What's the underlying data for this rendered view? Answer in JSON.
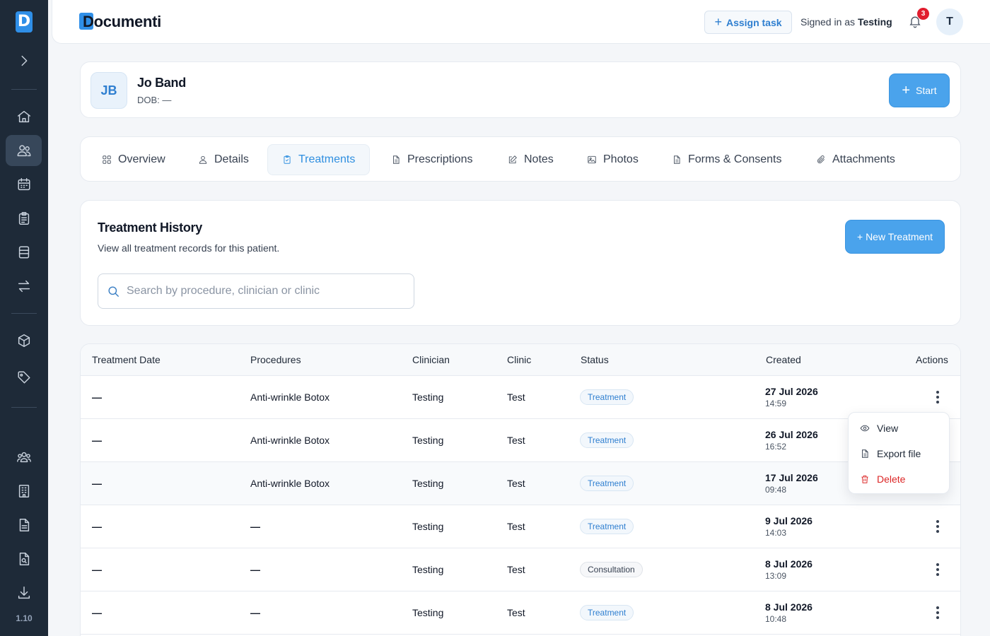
{
  "sidebar": {
    "logo_letter": "D",
    "version": "1.10",
    "items": [
      {
        "icon": "chevron-right-icon"
      },
      {
        "icon": "home-icon"
      },
      {
        "icon": "users-icon",
        "active": true
      },
      {
        "icon": "calendar-icon"
      },
      {
        "icon": "clipboard-icon"
      },
      {
        "icon": "layout-icon"
      },
      {
        "icon": "transfer-icon"
      },
      {
        "icon": "box-icon"
      },
      {
        "icon": "tag-icon"
      },
      {
        "icon": "team-icon"
      },
      {
        "icon": "building-icon"
      },
      {
        "icon": "file-text-icon"
      },
      {
        "icon": "file-search-icon"
      },
      {
        "icon": "download-icon"
      }
    ]
  },
  "header": {
    "brand": "Documenti",
    "assign_task": "Assign task",
    "signed_in_prefix": "Signed in as",
    "signed_in_user": "Testing",
    "notification_count": "3",
    "user_initial": "T"
  },
  "patient": {
    "initials": "JB",
    "name": "Jo Band",
    "dob": "DOB: —",
    "start_label": "Start"
  },
  "tabs": [
    {
      "label": "Overview",
      "icon": "grid-icon"
    },
    {
      "label": "Details",
      "icon": "user-icon"
    },
    {
      "label": "Treatments",
      "icon": "clipboard-check-icon",
      "active": true
    },
    {
      "label": "Prescriptions",
      "icon": "file-icon"
    },
    {
      "label": "Notes",
      "icon": "edit-icon"
    },
    {
      "label": "Photos",
      "icon": "image-icon"
    },
    {
      "label": "Forms & Consents",
      "icon": "file-icon"
    },
    {
      "label": "Attachments",
      "icon": "paperclip-icon"
    }
  ],
  "history": {
    "title": "Treatment History",
    "subtitle": "View all treatment records for this patient.",
    "new_button": "+ New Treatment",
    "search_placeholder": "Search by procedure, clinician or clinic"
  },
  "table": {
    "columns": [
      "Treatment Date",
      "Procedures",
      "Clinician",
      "Clinic",
      "Status",
      "Created",
      "Actions"
    ],
    "rows": [
      {
        "date": "—",
        "procedures": "Anti-wrinkle Botox",
        "clinician": "Testing",
        "clinic": "Test",
        "status": "Treatment",
        "created_date": "27 Jul 2026",
        "created_time": "14:59"
      },
      {
        "date": "—",
        "procedures": "Anti-wrinkle Botox",
        "clinician": "Testing",
        "clinic": "Test",
        "status": "Treatment",
        "created_date": "26 Jul 2026",
        "created_time": "16:52"
      },
      {
        "date": "—",
        "procedures": "Anti-wrinkle Botox",
        "clinician": "Testing",
        "clinic": "Test",
        "status": "Treatment",
        "created_date": "17 Jul 2026",
        "created_time": "09:48"
      },
      {
        "date": "—",
        "procedures": "—",
        "clinician": "Testing",
        "clinic": "Test",
        "status": "Treatment",
        "created_date": "9 Jul 2026",
        "created_time": "14:03"
      },
      {
        "date": "—",
        "procedures": "—",
        "clinician": "Testing",
        "clinic": "Test",
        "status": "Consultation",
        "created_date": "8 Jul 2026",
        "created_time": "13:09"
      },
      {
        "date": "—",
        "procedures": "—",
        "clinician": "Testing",
        "clinic": "Test",
        "status": "Treatment",
        "created_date": "8 Jul 2026",
        "created_time": "10:48"
      }
    ]
  },
  "row_menu": {
    "view": "View",
    "export": "Export file",
    "delete": "Delete"
  },
  "colors": {
    "accent": "#4aa3ec",
    "sidebar_bg": "#1e2a38",
    "danger": "#dc2626",
    "badge_red": "#e11d2e"
  }
}
